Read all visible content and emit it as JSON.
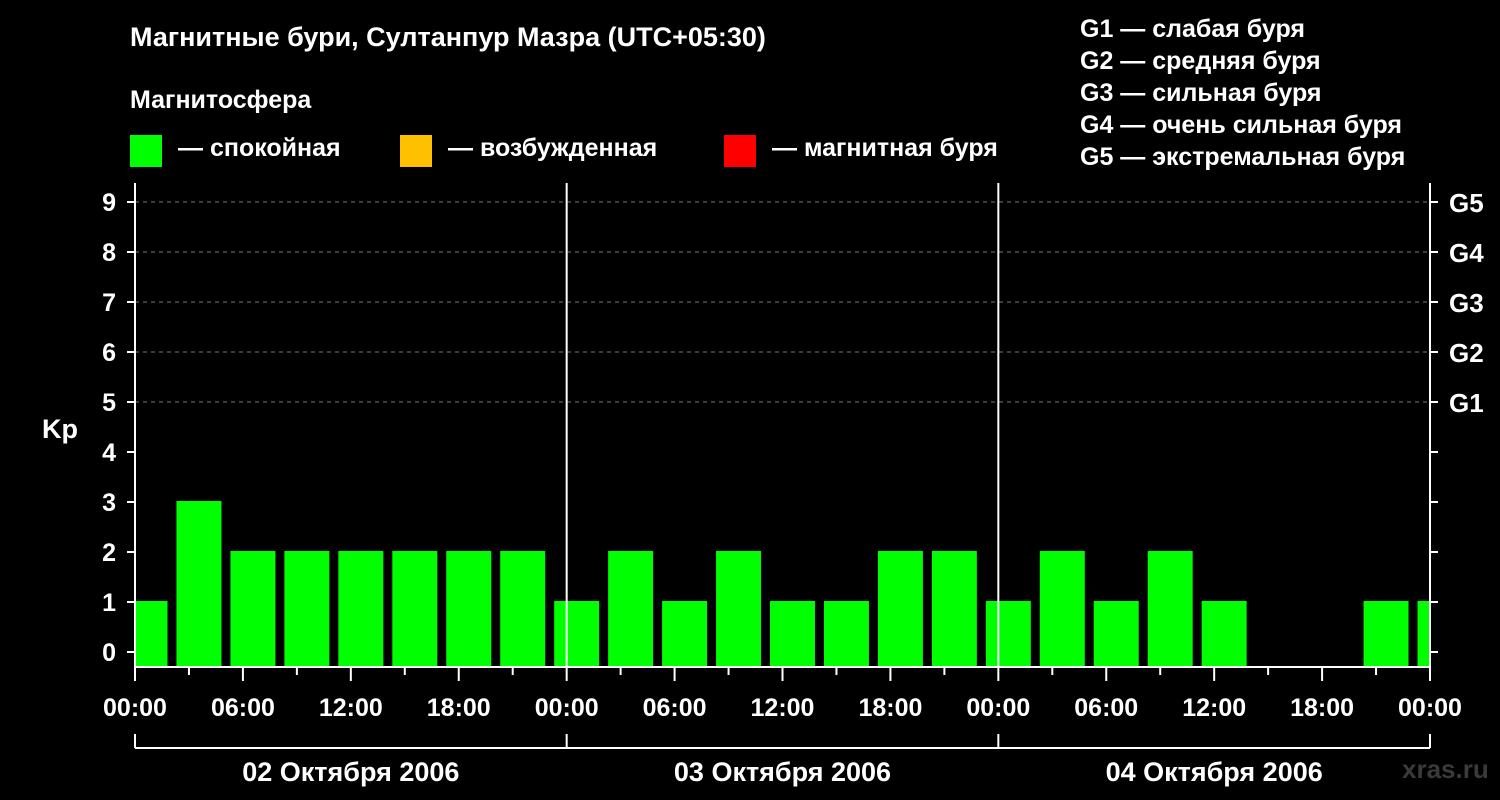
{
  "header": {
    "title": "Магнитные бури, Султанпур Мазра (UTC+05:30)",
    "subtitle": "Магнитосфера"
  },
  "legend": [
    {
      "label": "— спокойная",
      "color": "#00ff00"
    },
    {
      "label": "— возбужденная",
      "color": "#ffc000"
    },
    {
      "label": "— магнитная буря",
      "color": "#ff0000"
    }
  ],
  "g_scale": [
    "G1 — слабая буря",
    "G2 — средняя буря",
    "G3 — сильная буря",
    "G4 — очень сильная буря",
    "G5 — экстремальная буря"
  ],
  "watermark": "xras.ru",
  "chart_data": {
    "type": "bar",
    "ylabel": "Kp",
    "ylim": [
      0,
      9
    ],
    "yticks": [
      "0",
      "1",
      "2",
      "3",
      "4",
      "5",
      "6",
      "7",
      "8",
      "9"
    ],
    "right_ticks": [
      {
        "kp": 5,
        "label": "G1"
      },
      {
        "kp": 6,
        "label": "G2"
      },
      {
        "kp": 7,
        "label": "G3"
      },
      {
        "kp": 8,
        "label": "G4"
      },
      {
        "kp": 9,
        "label": "G5"
      }
    ],
    "xlim": [
      0,
      72
    ],
    "xticks": [
      {
        "h": 0,
        "label": "00:00"
      },
      {
        "h": 6,
        "label": "06:00"
      },
      {
        "h": 12,
        "label": "12:00"
      },
      {
        "h": 18,
        "label": "18:00"
      },
      {
        "h": 24,
        "label": "00:00"
      },
      {
        "h": 30,
        "label": "06:00"
      },
      {
        "h": 36,
        "label": "12:00"
      },
      {
        "h": 42,
        "label": "18:00"
      },
      {
        "h": 48,
        "label": "00:00"
      },
      {
        "h": 54,
        "label": "06:00"
      },
      {
        "h": 60,
        "label": "12:00"
      },
      {
        "h": 66,
        "label": "18:00"
      },
      {
        "h": 72,
        "label": "00:00"
      }
    ],
    "days": [
      "02 Октября 2006",
      "03 Октября 2006",
      "04 Октября 2006"
    ],
    "grid": "dashed horizontal at Kp 5–9",
    "bars": [
      {
        "start": 0,
        "end": 1.75,
        "kp": 1,
        "color": "#00ff00"
      },
      {
        "start": 2.25,
        "end": 4.75,
        "kp": 3,
        "color": "#00ff00"
      },
      {
        "start": 5.25,
        "end": 7.75,
        "kp": 2,
        "color": "#00ff00"
      },
      {
        "start": 8.25,
        "end": 10.75,
        "kp": 2,
        "color": "#00ff00"
      },
      {
        "start": 11.25,
        "end": 13.75,
        "kp": 2,
        "color": "#00ff00"
      },
      {
        "start": 14.25,
        "end": 16.75,
        "kp": 2,
        "color": "#00ff00"
      },
      {
        "start": 17.25,
        "end": 19.75,
        "kp": 2,
        "color": "#00ff00"
      },
      {
        "start": 20.25,
        "end": 22.75,
        "kp": 2,
        "color": "#00ff00"
      },
      {
        "start": 23.25,
        "end": 25.75,
        "kp": 1,
        "color": "#00ff00"
      },
      {
        "start": 26.25,
        "end": 28.75,
        "kp": 2,
        "color": "#00ff00"
      },
      {
        "start": 29.25,
        "end": 31.75,
        "kp": 1,
        "color": "#00ff00"
      },
      {
        "start": 32.25,
        "end": 34.75,
        "kp": 2,
        "color": "#00ff00"
      },
      {
        "start": 35.25,
        "end": 37.75,
        "kp": 1,
        "color": "#00ff00"
      },
      {
        "start": 38.25,
        "end": 40.75,
        "kp": 1,
        "color": "#00ff00"
      },
      {
        "start": 41.25,
        "end": 43.75,
        "kp": 2,
        "color": "#00ff00"
      },
      {
        "start": 44.25,
        "end": 46.75,
        "kp": 2,
        "color": "#00ff00"
      },
      {
        "start": 47.25,
        "end": 49.75,
        "kp": 1,
        "color": "#00ff00"
      },
      {
        "start": 50.25,
        "end": 52.75,
        "kp": 2,
        "color": "#00ff00"
      },
      {
        "start": 53.25,
        "end": 55.75,
        "kp": 1,
        "color": "#00ff00"
      },
      {
        "start": 56.25,
        "end": 58.75,
        "kp": 2,
        "color": "#00ff00"
      },
      {
        "start": 59.25,
        "end": 61.75,
        "kp": 1,
        "color": "#00ff00"
      },
      {
        "start": 68.25,
        "end": 70.75,
        "kp": 1,
        "color": "#00ff00"
      },
      {
        "start": 71.25,
        "end": 71.9,
        "kp": 1,
        "color": "#00ff00"
      }
    ]
  }
}
